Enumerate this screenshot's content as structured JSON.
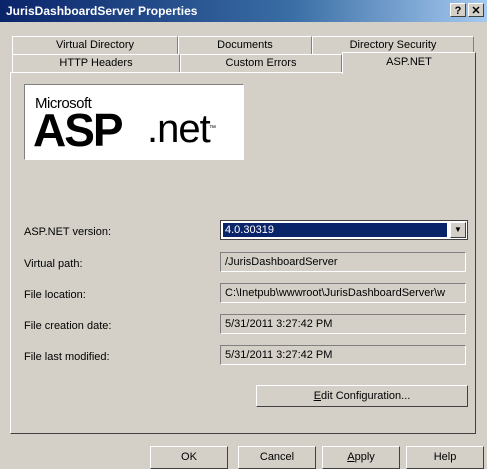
{
  "window": {
    "title": "JurisDashboardServer Properties",
    "help_label": "?",
    "close_label": "✕"
  },
  "tabs_row1": [
    "Virtual Directory",
    "Documents",
    "Directory Security"
  ],
  "tabs_row2": [
    "HTTP Headers",
    "Custom Errors",
    "ASP.NET"
  ],
  "logo": {
    "brand": "Microsoft",
    "word1": "ASP",
    "word2": ".net",
    "tm": "™"
  },
  "fields": {
    "version_label": "ASP.NET version:",
    "version_value": "4.0.30319",
    "virtual_path_label": "Virtual path:",
    "virtual_path_value": "/JurisDashboardServer",
    "file_location_label": "File location:",
    "file_location_value": "C:\\Inetpub\\wwwroot\\JurisDashboardServer\\w",
    "creation_label": "File creation date:",
    "creation_value": "5/31/2011 3:27:42 PM",
    "modified_label": "File last modified:",
    "modified_value": "5/31/2011 3:27:42 PM"
  },
  "edit_config": {
    "accel": "E",
    "rest": "dit Configuration..."
  },
  "buttons": {
    "ok": "OK",
    "cancel": "Cancel",
    "apply_accel": "A",
    "apply_rest": "pply",
    "help": "Help"
  }
}
